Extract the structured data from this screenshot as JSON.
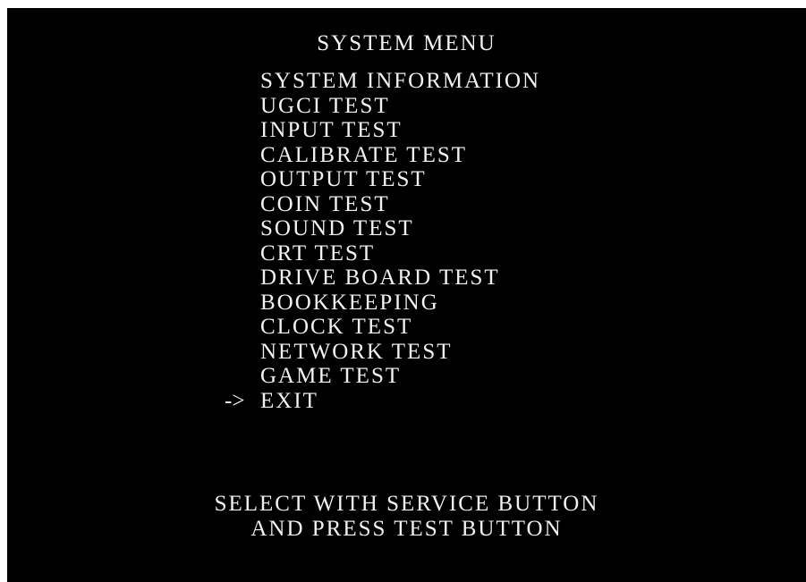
{
  "title": "SYSTEM MENU",
  "menu": {
    "items": [
      {
        "label": "SYSTEM INFORMATION",
        "selected": false
      },
      {
        "label": "UGCI TEST",
        "selected": false
      },
      {
        "label": "INPUT TEST",
        "selected": false
      },
      {
        "label": "CALIBRATE TEST",
        "selected": false
      },
      {
        "label": "OUTPUT TEST",
        "selected": false
      },
      {
        "label": "COIN TEST",
        "selected": false
      },
      {
        "label": "SOUND TEST",
        "selected": false
      },
      {
        "label": "CRT TEST",
        "selected": false
      },
      {
        "label": "DRIVE BOARD TEST",
        "selected": false
      },
      {
        "label": "BOOKKEEPING",
        "selected": false
      },
      {
        "label": "CLOCK TEST",
        "selected": false
      },
      {
        "label": "NETWORK TEST",
        "selected": false
      },
      {
        "label": "GAME TEST",
        "selected": false
      },
      {
        "label": "EXIT",
        "selected": true
      }
    ],
    "cursor": "->"
  },
  "instructions": {
    "line1": "SELECT WITH SERVICE BUTTON",
    "line2": "AND PRESS TEST BUTTON"
  },
  "colors": {
    "background": "#000000",
    "text": "#f2f2f2"
  }
}
